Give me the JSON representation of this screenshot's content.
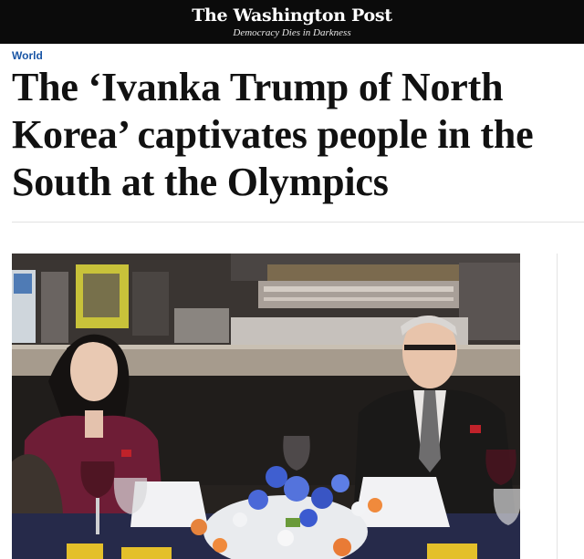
{
  "masthead": {
    "logo": "The Washington Post",
    "tagline": "Democracy Dies in Darkness"
  },
  "article": {
    "section": "World",
    "headline": "The ‘Ivanka Trump of North Korea’ captivates people in the South at the Olympics"
  },
  "photo": {
    "subject": "dinner-scene-photo"
  }
}
